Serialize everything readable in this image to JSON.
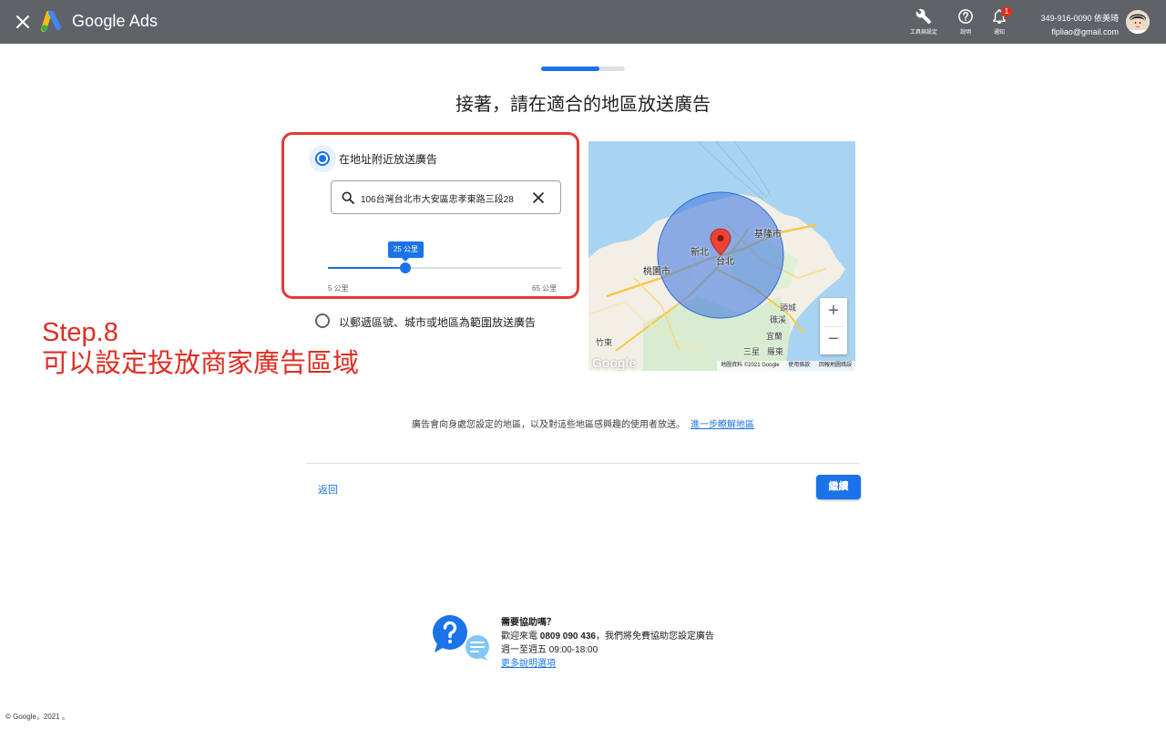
{
  "header": {
    "brand": "Google Ads",
    "tools": [
      {
        "label": "工具與設定",
        "icon": "wrench-icon"
      },
      {
        "label": "說明",
        "icon": "help-circle-icon"
      },
      {
        "label": "通知",
        "icon": "bell-icon",
        "badge": "1"
      }
    ],
    "account_id": "349-916-0090 依美琦",
    "account_email": "flpliao@gmail.com"
  },
  "progress": {
    "value_percent": 70
  },
  "page_title": "接著，請在適合的地區放送廣告",
  "location": {
    "option_nearby_label": "在地址附近放送廣告",
    "option_nearby_selected": true,
    "address_value": "106台灣台北市大安區忠孝東路三段28",
    "radius": {
      "current_label": "25 公里",
      "min_label": "5 公里",
      "max_label": "65 公里",
      "value": 25,
      "min": 5,
      "max": 65
    },
    "option_region_label": "以郵遞區號、城市或地區為範圍放送廣告",
    "option_region_selected": false
  },
  "map": {
    "labels": {
      "keelung": "基隆市",
      "newtaipei": "新北",
      "taipei": "台北",
      "taoyuan": "桃園市",
      "toucheng": "頭城",
      "jiaoxi": "礁溪",
      "yilan": "宜蘭",
      "zhudong": "竹東",
      "sanxing": "三星",
      "luodong": "羅東"
    },
    "watermark": "Google",
    "footer": [
      "地圖資料 ©2021 Google",
      "使用條款",
      "回報地圖錯誤"
    ],
    "zoom_in": "+",
    "zoom_out": "−"
  },
  "annotation": {
    "line1": "Step.8",
    "line2": "可以設定投放商家廣告區域"
  },
  "info": {
    "text": "廣告會向身處您設定的地區，以及對這些地區感興趣的使用者放送。",
    "link": "進一步瞭解地區"
  },
  "actions": {
    "back": "返回",
    "continue": "繼續"
  },
  "help": {
    "title": "需要協助嗎？",
    "line_prefix": "歡迎來電",
    "phone": "0809 090 436",
    "line_suffix": "，我們將免費協助您設定廣告",
    "hours": "週一至週五 09:00-18:00",
    "more_link": "更多說明選項"
  },
  "footer": {
    "copyright": "© Google，2021 。"
  },
  "colors": {
    "accent": "#1a73e8",
    "topbar": "#5f6368",
    "annotation": "#e02d23",
    "highlight": "#e53935"
  }
}
